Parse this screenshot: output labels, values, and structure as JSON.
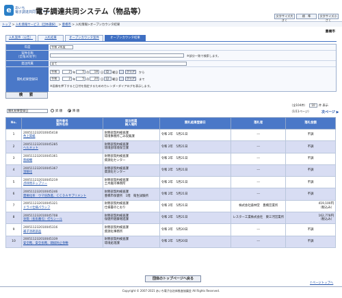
{
  "header": {
    "logo_line1": "あいち",
    "logo_line2": "電子調達共同システム",
    "logo_mark": "e",
    "app_title": "電子調達共同システム（物品等）",
    "buttons": [
      "文字サイズ大きく",
      "標　準",
      "文字サイズ小さく"
    ]
  },
  "breadcrumb": {
    "items": [
      "トップ",
      "入札情報サービス（団体選択）",
      "豊橋市"
    ],
    "current": "入札情報>オープンカウンタ結果",
    "sep": ">"
  },
  "organization": "豊橋市",
  "tabs": [
    "入札案件（公告）",
    "入札結果",
    "オープンカウンタ案件",
    "オープンカウンタ結果"
  ],
  "form": {
    "year_label": "年度",
    "year_value": "令和 2年度",
    "case_label": "案件名称",
    "case_sublabel": "（全角30文字）",
    "case_note": "※部分一致で検索します。",
    "dept_label": "発注所属",
    "dept_value": "全て",
    "date_label": "開札結果登録日",
    "from": {
      "era": "令和",
      "year": "2",
      "month": "5",
      "day": "18",
      "dow": "月",
      "suffix": "から"
    },
    "to": {
      "era": "令和",
      "year": "2",
      "month": "5",
      "day": "24",
      "dow": "日",
      "suffix": "まで"
    },
    "unit_year": "年",
    "unit_month": "月",
    "unit_day": "日",
    "unit_dow": "曜日",
    "clear_label": "クリア",
    "calendar_note": "※画像を押下すると日付を指定するためのカレンダーダイアログを表示します。",
    "search_label": "検　索"
  },
  "list_controls": {
    "order_value": "開札結果登録日",
    "asc_label": "昇 順",
    "desc_label": "降 順",
    "count_text": "（全104件）",
    "per_page_value": "10",
    "per_page_suffix": "件 表示",
    "page_info": "（1/11ページ）",
    "next_label": "次ページ ▶"
  },
  "table": {
    "headers": {
      "no": "No.",
      "case_a": "案件番号",
      "case_b": "案件名称",
      "dept_a": "発注所属",
      "dept_b": "納入場所",
      "date": "開札結果登録日",
      "winner": "落札者",
      "amount": "落札金額"
    },
    "rows": [
      {
        "no": "1",
        "case_no": "200511232010045418",
        "name": "色上質紙",
        "dept": "財務部契約検査課",
        "place": "環境事務所ごみ収集課",
        "date": "令和 2年　5月21日",
        "winner": "---",
        "amount": "不調",
        "amount2": ""
      },
      {
        "no": "2",
        "case_no": "200511232010045285",
        "name": "ヘルメット",
        "dept": "財務部契約検査課",
        "place": "環境部環境保全課",
        "date": "令和 2年　5月21日",
        "winner": "---",
        "amount": "不調",
        "amount2": ""
      },
      {
        "no": "3",
        "case_no": "200511232010045361",
        "name": "無線機",
        "dept": "財務部契約検査課",
        "place": "資源化センター",
        "date": "令和 2年　5月21日",
        "winner": "---",
        "amount": "不調",
        "amount2": ""
      },
      {
        "no": "4",
        "case_no": "200511232010045367",
        "name": "温暖化",
        "dept": "財務部契約検査課",
        "place": "資源化センター",
        "date": "令和 2年　5月21日",
        "winner": "---",
        "amount": "不調",
        "amount2": ""
      },
      {
        "no": "5",
        "case_no": "200511232010045219",
        "name": "点呼用チップソー",
        "dept": "財務部契約検査課",
        "place": "土木維持事務所",
        "date": "令和 2年　5月21日",
        "winner": "---",
        "amount": "不調",
        "amount2": ""
      },
      {
        "no": "6",
        "case_no": "200511232010045246",
        "name": "需要化率　ウマ倍改進、ＣＣＤＡサプリメント",
        "dept": "財務部契約検査課",
        "place": "豊橋市保健所　1階　衛生試験所",
        "date": "令和 2年　5月21日",
        "winner": "---",
        "amount": "不調",
        "amount2": ""
      },
      {
        "no": "7",
        "case_no": "200511232010045321",
        "name": "ドライ仕様パラシフ",
        "dept": "財務部契約検査課",
        "place": "仕様書のとおり",
        "date": "令和 2年　5月21日",
        "winner": "株式会社森林堂　豊橋営業所",
        "amount": "419,100円",
        "amount2": "（税込み）"
      },
      {
        "no": "8",
        "case_no": "200511232010045708",
        "name": "封筒（長形番号）打ちシール",
        "dept": "財務部契約検査課",
        "place": "保健所健康増進課",
        "date": "令和 2年　5月21日",
        "winner": "レスター工業株式会社　東三河営業所",
        "amount": "162,778円",
        "amount2": "（税込み）"
      },
      {
        "no": "9",
        "case_no": "200511232010045316",
        "name": "補子消耗部品",
        "dept": "財務部契約検査課",
        "place": "資源化事務所",
        "date": "令和 2年　5月20日",
        "winner": "---",
        "amount": "不調",
        "amount2": ""
      },
      {
        "no": "10",
        "case_no": "200511232010045339",
        "name": "安全靴、安全長靴、踏抜防止金敷",
        "dept": "財務部契約検査課",
        "place": "環境処理課",
        "date": "令和 2年　5月20日",
        "winner": "---",
        "amount": "不調",
        "amount2": ""
      }
    ]
  },
  "back_button": "団体のトップページへ戻る",
  "page_top": "↑ページトップへ",
  "footer": "Copyright © 2007-2021 あいち電子自治体推進協議会 All Rights Reserved."
}
